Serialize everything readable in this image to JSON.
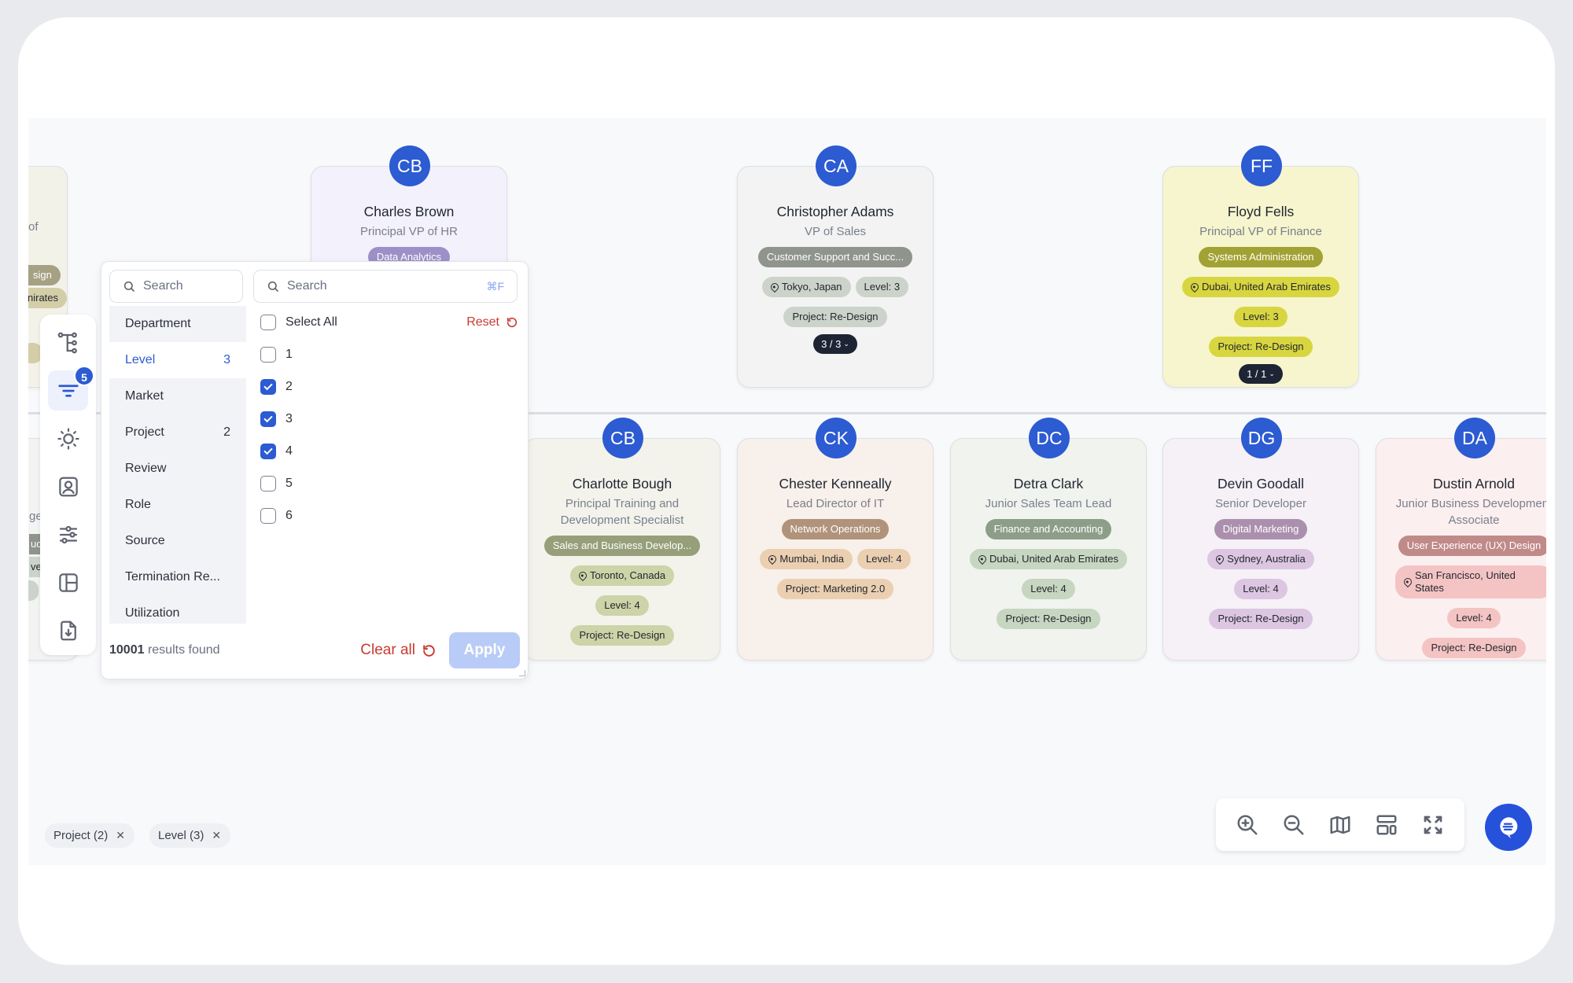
{
  "colors": {
    "accent": "#2c5bd2",
    "danger": "#c9392f",
    "apply_disabled": "#b9cbf7",
    "avatar": "#2c5bd2",
    "count_pill": "#1d2433"
  },
  "left_toolbar": {
    "items": [
      {
        "icon": "org-tree-icon",
        "active": false
      },
      {
        "icon": "filter-icon",
        "active": true,
        "badge": "5"
      },
      {
        "icon": "theme-sun-icon",
        "active": false
      },
      {
        "icon": "profile-card-icon",
        "active": false
      },
      {
        "icon": "sliders-icon",
        "active": false
      },
      {
        "icon": "layout-icon",
        "active": false
      },
      {
        "icon": "export-file-icon",
        "active": false
      }
    ]
  },
  "filter_panel": {
    "category_search_placeholder": "Search",
    "option_search_placeholder": "Search",
    "option_search_shortcut": "⌘F",
    "categories": [
      {
        "label": "Department",
        "count": ""
      },
      {
        "label": "Level",
        "count": "3",
        "active": true
      },
      {
        "label": "Market",
        "count": ""
      },
      {
        "label": "Project",
        "count": "2"
      },
      {
        "label": "Review",
        "count": ""
      },
      {
        "label": "Role",
        "count": ""
      },
      {
        "label": "Source",
        "count": ""
      },
      {
        "label": "Termination Re...",
        "count": ""
      },
      {
        "label": "Utilization",
        "count": ""
      }
    ],
    "select_all_label": "Select All",
    "reset_label": "Reset",
    "options": [
      {
        "label": "1",
        "checked": false
      },
      {
        "label": "2",
        "checked": true
      },
      {
        "label": "3",
        "checked": true
      },
      {
        "label": "4",
        "checked": true
      },
      {
        "label": "5",
        "checked": false
      },
      {
        "label": "6",
        "checked": false
      }
    ],
    "results_count": "10001",
    "results_suffix": "results found",
    "clear_all_label": "Clear all",
    "apply_label": "Apply"
  },
  "active_filter_chips": [
    {
      "label": "Project (2)"
    },
    {
      "label": "Level (3)"
    }
  ],
  "partial_cards": {
    "top_left": {
      "title_fragment": "of",
      "tag1": "sign",
      "tag2": "nirates"
    },
    "bottom_left": {
      "title_fragment": "ge",
      "tag1": "uc",
      "tag2": "vel:"
    }
  },
  "cards_top": [
    {
      "initials": "CB",
      "name": "Charles Brown",
      "title": "Principal VP of HR",
      "bg": "#f3f1fc",
      "dept": "Data Analytics",
      "dept_color": "#9d8fc7",
      "tag_color": "#d4cdea",
      "location": "",
      "level": "",
      "project": "",
      "count": ""
    },
    {
      "initials": "CA",
      "name": "Christopher Adams",
      "title": "VP of Sales",
      "bg": "#f2f3f2",
      "dept": "Customer Support and Succ...",
      "dept_color": "#8f948c",
      "tag_color": "#ccd3ca",
      "location": "Tokyo, Japan",
      "level": "Level: 3",
      "project": "Project:  Re-Design",
      "count": "3 / 3"
    },
    {
      "initials": "FF",
      "name": "Floyd Fells",
      "title": "Principal VP of Finance",
      "bg": "#f6f5cd",
      "dept": "Systems Administration",
      "dept_color": "#a2a234",
      "tag_color": "#d8d640",
      "location": "Dubai, United Arab Emirates",
      "level": "Level: 3",
      "project": "Project:  Re-Design",
      "count": "1 / 1"
    }
  ],
  "cards_bottom": [
    {
      "initials": "CB",
      "name": "Charlotte Bough",
      "title": "Principal Training and Development Specialist",
      "bg": "#f3f3ec",
      "dept": "Sales and Business Develop...",
      "dept_color": "#979f7a",
      "tag_color": "#ccd4a8",
      "location": "Toronto, Canada",
      "level": "Level: 4",
      "project": "Project:  Re-Design"
    },
    {
      "initials": "CK",
      "name": "Chester Kenneally",
      "title": "Lead Director of IT",
      "bg": "#f8f0ea",
      "dept": "Network Operations",
      "dept_color": "#b0937a",
      "tag_color": "#ebcfb1",
      "location": "Mumbai, India",
      "level": "Level: 4",
      "project": "Project:  Marketing 2.0"
    },
    {
      "initials": "DC",
      "name": "Detra Clark",
      "title": "Junior Sales Team Lead",
      "bg": "#f0f3ee",
      "dept": "Finance and Accounting",
      "dept_color": "#8d9e88",
      "tag_color": "#c6d6c0",
      "location": "Dubai, United Arab Emirates",
      "level": "Level: 4",
      "project": "Project:  Re-Design"
    },
    {
      "initials": "DG",
      "name": "Devin Goodall",
      "title": "Senior Developer",
      "bg": "#f5f1f7",
      "dept": "Digital Marketing",
      "dept_color": "#ab90ad",
      "tag_color": "#dcc6e2",
      "location": "Sydney, Australia",
      "level": "Level: 4",
      "project": "Project:  Re-Design"
    },
    {
      "initials": "DA",
      "name": "Dustin Arnold",
      "title": "Junior Business Development Associate",
      "bg": "#fcefef",
      "dept": "User Experience (UX) Design",
      "dept_color": "#c08a89",
      "tag_color": "#f3c4c3",
      "location": "San Francisco, United States",
      "level": "Level: 4",
      "project": "Project:  Re-Design"
    }
  ],
  "view_controls": [
    {
      "icon": "zoom-in-icon"
    },
    {
      "icon": "zoom-out-icon"
    },
    {
      "icon": "map-icon"
    },
    {
      "icon": "layout-toggle-icon"
    },
    {
      "icon": "fullscreen-icon"
    }
  ],
  "chat_button": {
    "icon": "chat-bubble-icon"
  }
}
